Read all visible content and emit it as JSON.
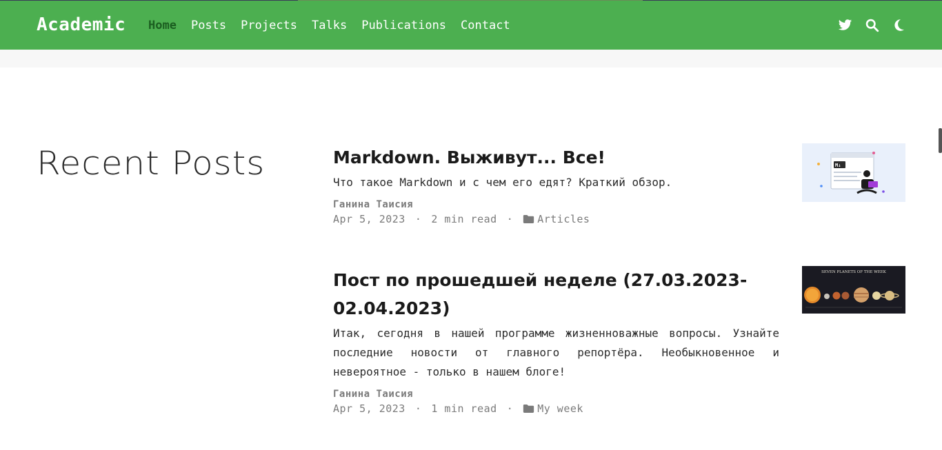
{
  "navbar": {
    "brand": "Academic",
    "links": [
      {
        "label": "Home",
        "active": true
      },
      {
        "label": "Posts",
        "active": false
      },
      {
        "label": "Projects",
        "active": false
      },
      {
        "label": "Talks",
        "active": false
      },
      {
        "label": "Publications",
        "active": false
      },
      {
        "label": "Contact",
        "active": false
      }
    ],
    "icons": [
      "twitter-icon",
      "search-icon",
      "moon-icon"
    ],
    "bg_color": "#4caf50",
    "active_color": "#1b5e20"
  },
  "section": {
    "title": "Recent Posts"
  },
  "posts": [
    {
      "title": "Markdown. Выживут... Все!",
      "summary": "Что такое Markdown и с чем его едят? Краткий обзор.",
      "author": "Ганина Таисия",
      "date": "Apr 5, 2023",
      "dot": "·",
      "reading_time": "2 min read",
      "category": "Articles",
      "thumbnail": "markdown-illustration"
    },
    {
      "title": "Пост по прошедшей неделе (27.03.2023-02.04.2023)",
      "summary": "Итак, сегодня в нашей программе жизненноважные вопросы. Узнайте последние новости от главного репортёра. Необыкновенное и невероятное - только в нашем блоге!",
      "author": "Ганина Таисия",
      "date": "Apr 5, 2023",
      "dot": "·",
      "reading_time": "1 min read",
      "category": "My week",
      "thumbnail": "planets-image",
      "thumbnail_caption": "SEVEN PLANETS OF THE WEEK"
    }
  ]
}
